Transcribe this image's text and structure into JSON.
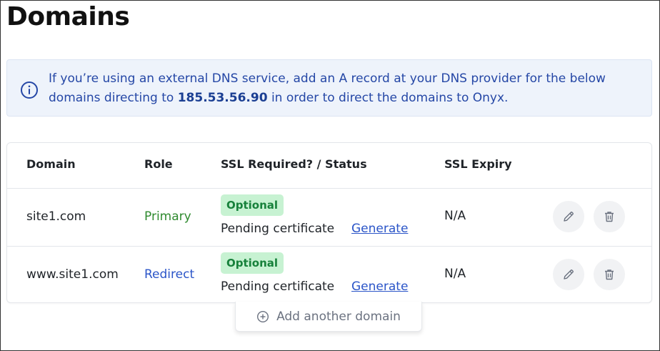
{
  "page": {
    "title": "Domains"
  },
  "info_banner": {
    "icon": "info-icon",
    "text_before": "If you’re using an external DNS service, add an A record at your DNS provider for the below domains directing to ",
    "ip": "185.53.56.90",
    "text_after": " in order to direct the domains to Onyx."
  },
  "table": {
    "headers": {
      "domain": "Domain",
      "role": "Role",
      "ssl": "SSL Required? / Status",
      "expiry": "SSL Expiry"
    },
    "rows": [
      {
        "domain": "site1.com",
        "role": "Primary",
        "ssl_badge": "Optional",
        "ssl_status": "Pending certificate",
        "action_link": "Generate",
        "expiry": "N/A"
      },
      {
        "domain": "www.site1.com",
        "role": "Redirect",
        "ssl_badge": "Optional",
        "ssl_status": "Pending certificate",
        "action_link": "Generate",
        "expiry": "N/A"
      }
    ]
  },
  "add_domain": {
    "label": "Add another domain",
    "icon": "plus-circle-icon"
  },
  "colors": {
    "banner_bg": "#eef3fb",
    "banner_text": "#2547a6",
    "primary_role": "#2f8a2f",
    "redirect_role": "#2b55c8",
    "badge_bg": "#c7f2d2",
    "badge_text": "#17813b",
    "link": "#2b55c8"
  }
}
